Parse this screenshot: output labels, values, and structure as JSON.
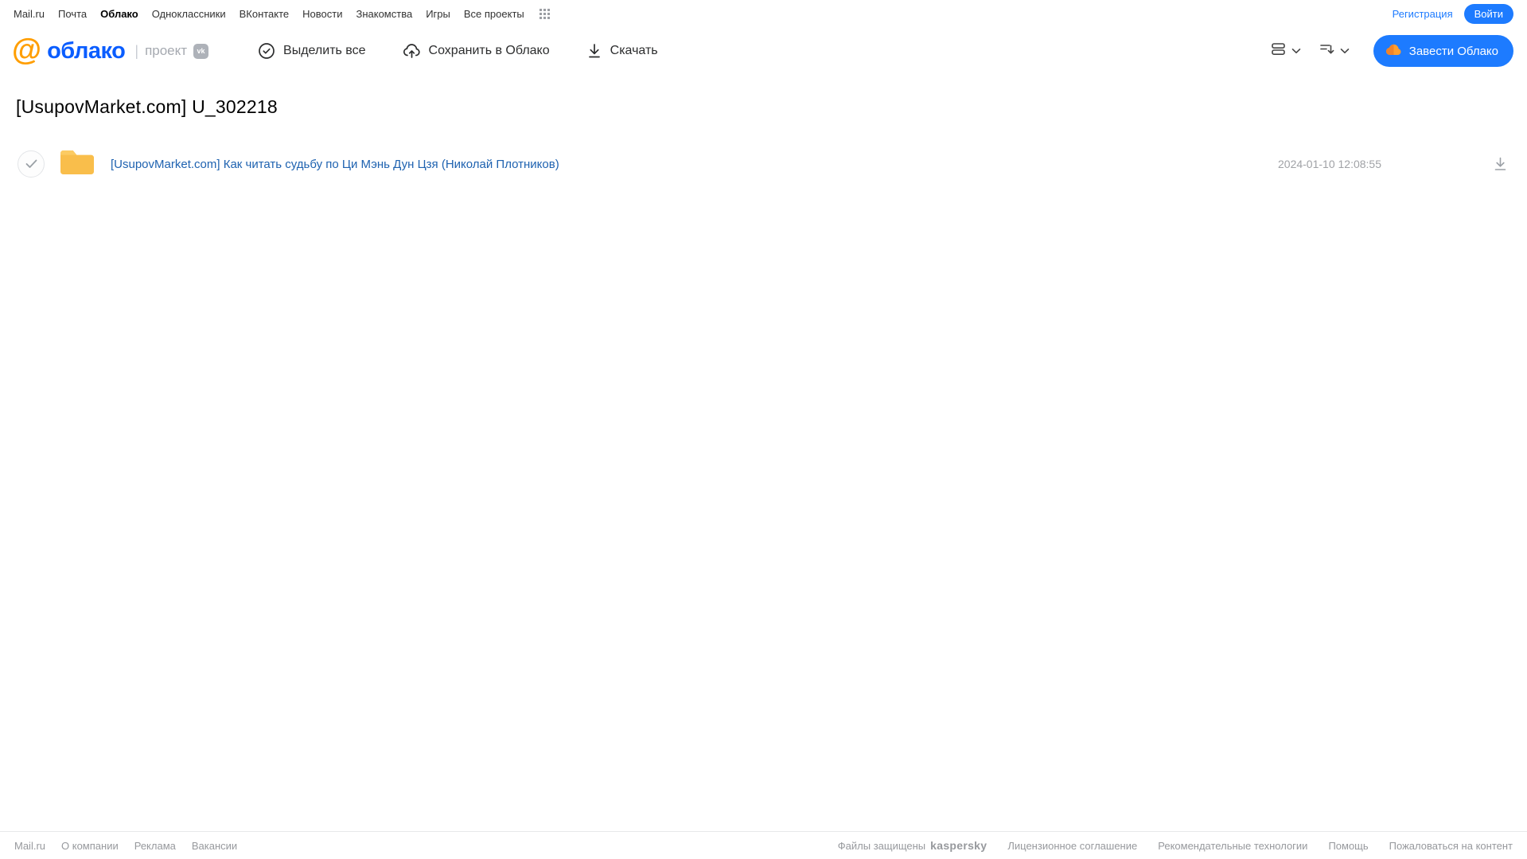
{
  "top_nav": {
    "links": [
      "Mail.ru",
      "Почта",
      "Облако",
      "Одноклассники",
      "ВКонтакте",
      "Новости",
      "Знакомства",
      "Игры",
      "Все проекты"
    ],
    "active_link": "Облако",
    "registration": "Регистрация",
    "login": "Войти"
  },
  "header": {
    "logo_at": "@",
    "logo_text": "облако",
    "project_label": "проект",
    "vk_badge": "vk",
    "toolbar": {
      "select_all": "Выделить все",
      "save_to_cloud": "Сохранить в Облако",
      "download": "Скачать"
    },
    "create_cloud": "Завести Облако"
  },
  "main": {
    "title": "[UsupovMarket.com] U_302218",
    "files": [
      {
        "type": "folder",
        "name": "[UsupovMarket.com] Как читать судьбу по Ци Мэнь Дун Цзя (Николай Плотников)",
        "modified": "2024-01-10 12:08:55"
      }
    ]
  },
  "footer": {
    "left_links": [
      "Mail.ru",
      "О компании",
      "Реклама",
      "Вакансии"
    ],
    "protected_label": "Файлы защищены",
    "kaspersky_logo": "kaspersky",
    "right_links": [
      "Лицензионное соглашение",
      "Рекомендательные технологии",
      "Помощь",
      "Пожаловаться на контент"
    ]
  },
  "colors": {
    "accent_blue": "#1d7bff",
    "logo_blue": "#0a5dff",
    "logo_orange": "#ff9e00",
    "folder_yellow": "#f9be4b",
    "kaspersky_green": "#00a88e",
    "file_link_blue": "#1e62b0"
  }
}
